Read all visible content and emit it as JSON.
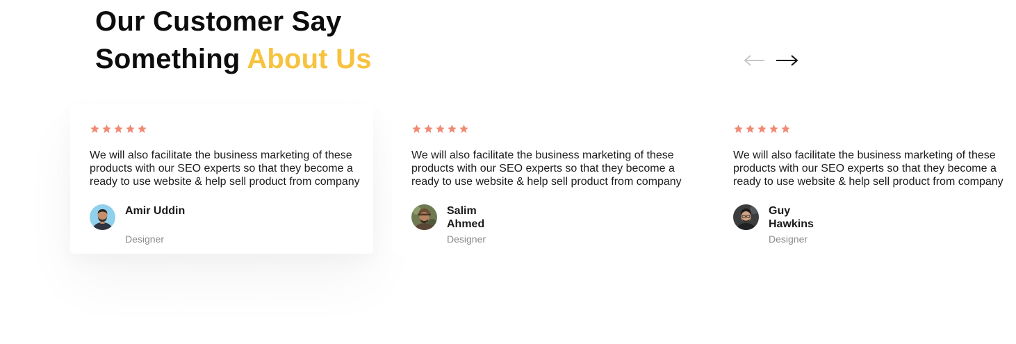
{
  "section": {
    "title_part1": "Our Customer Say Something",
    "title_accent": "About Us",
    "accent_color": "#f7c23e"
  },
  "navigation": {
    "prev_icon": "arrow-left-icon",
    "next_icon": "arrow-right-icon"
  },
  "star_color": "#f08a74",
  "testimonials": [
    {
      "rating": 5,
      "quote": "We will also facilitate the business marketing of these products with our SEO experts so that they become a ready to use website & help sell product from company",
      "name": "Amir Uddin",
      "role": "Designer"
    },
    {
      "rating": 5,
      "quote": "We will also facilitate the business marketing of these products with our SEO experts so that they become a ready to use website & help sell product from company",
      "name": "Salim Ahmed",
      "role": "Designer"
    },
    {
      "rating": 5,
      "quote": "We will also facilitate the business marketing of these products with our SEO experts so that they become a ready to use website & help sell product from company",
      "name": "Guy Hawkins",
      "role": "Designer"
    }
  ]
}
